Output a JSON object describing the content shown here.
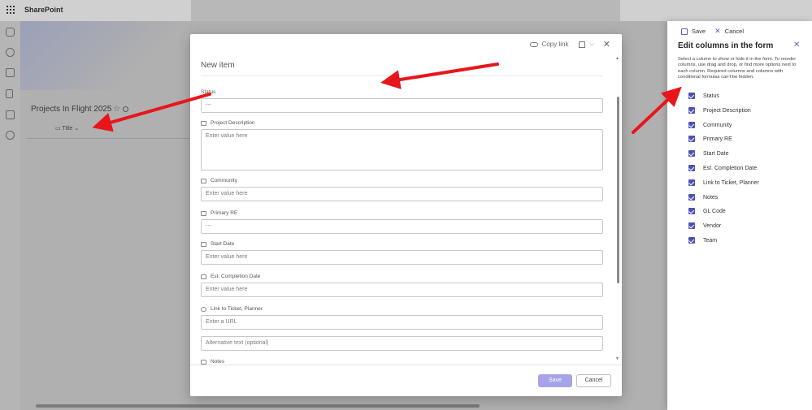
{
  "suite": {
    "app_name": "SharePoint"
  },
  "list": {
    "title": "Projects In Flight 2025",
    "column_header": "Title",
    "column_header_chevron": "⌄"
  },
  "dialog": {
    "copy_link": "Copy link",
    "title": "New item",
    "fields": [
      {
        "label": "Status",
        "value": "---",
        "placeholder": ""
      },
      {
        "label": "Project Description",
        "value": "",
        "placeholder": "Enter value here"
      },
      {
        "label": "Community",
        "value": "",
        "placeholder": "Enter value here"
      },
      {
        "label": "Primary RE",
        "value": "---",
        "placeholder": ""
      },
      {
        "label": "Start Date",
        "value": "",
        "placeholder": "Enter value here"
      },
      {
        "label": "Est. Completion Date",
        "value": "",
        "placeholder": "Enter value here"
      },
      {
        "label": "Link to Ticket, Planner",
        "value": "",
        "placeholder": "Enter a URL"
      },
      {
        "label": "",
        "value": "",
        "placeholder": "Alternative text (optional)"
      },
      {
        "label": "Notes",
        "value": "",
        "placeholder": ""
      }
    ],
    "save_label": "Save",
    "cancel_label": "Cancel"
  },
  "panel": {
    "save_label": "Save",
    "cancel_label": "Cancel",
    "title": "Edit columns in the form",
    "description": "Select a column to show or hide it in the form. To reorder columns, use drag and drop, or find more options next to each column. Required columns and columns with conditional formulas can't be hidden.",
    "columns": [
      {
        "label": "Status",
        "checked": true
      },
      {
        "label": "Project Description",
        "checked": true
      },
      {
        "label": "Community",
        "checked": true
      },
      {
        "label": "Primary RE",
        "checked": true
      },
      {
        "label": "Start Date",
        "checked": true
      },
      {
        "label": "Est. Completion Date",
        "checked": true
      },
      {
        "label": "Link to Ticket, Planner",
        "checked": true
      },
      {
        "label": "Notes",
        "checked": true
      },
      {
        "label": "GL Code",
        "checked": true
      },
      {
        "label": "Vendor",
        "checked": true
      },
      {
        "label": "Team",
        "checked": true
      }
    ]
  },
  "colors": {
    "accent": "#5b5fc7",
    "annotation_arrow": "#e8161b",
    "primary_button_disabled": "#a7a3e8"
  }
}
